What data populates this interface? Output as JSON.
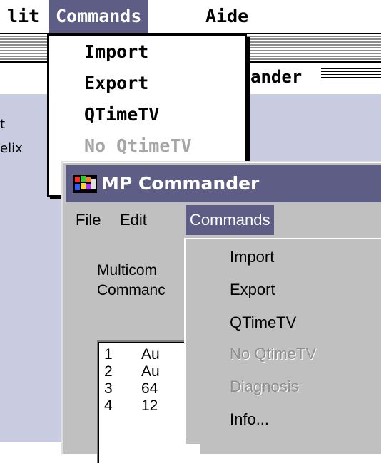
{
  "mac_window": {
    "menubar": {
      "items": [
        {
          "label": "lit",
          "selected": false
        },
        {
          "label": "Commands",
          "selected": true
        },
        {
          "label": "Aide",
          "selected": false
        }
      ]
    },
    "title_partial": "ander",
    "side_texts": [
      "t",
      "elix"
    ],
    "commands_menu": [
      {
        "label": "Import",
        "enabled": true
      },
      {
        "label": "Export",
        "enabled": true
      },
      {
        "label": "QTimeTV",
        "enabled": true
      },
      {
        "label": "No QtimeTV",
        "enabled": false
      }
    ]
  },
  "win_window": {
    "title": "MP Commander",
    "app_icon": "multicolor-flag-icon",
    "menubar": {
      "items": [
        {
          "label": "File",
          "selected": false
        },
        {
          "label": "Edit",
          "selected": false
        },
        {
          "label": "Commands",
          "selected": true
        }
      ]
    },
    "body_lines": [
      "Multicom",
      "Commanc"
    ],
    "list_rows": [
      {
        "num": "1",
        "text": "Au"
      },
      {
        "num": "2",
        "text": "Au"
      },
      {
        "num": "3",
        "text": "64"
      },
      {
        "num": "4",
        "text": "12"
      }
    ],
    "commands_menu": [
      {
        "label": "Import",
        "enabled": true
      },
      {
        "label": "Export",
        "enabled": true
      },
      {
        "label": "QTimeTV",
        "enabled": true
      },
      {
        "label": "No QtimeTV",
        "enabled": false
      },
      {
        "label": "Diagnosis",
        "enabled": false
      },
      {
        "label": "Info...",
        "enabled": true
      }
    ]
  },
  "colors": {
    "selection": "#5d5d86",
    "mac_content_bg": "#c9cbe0",
    "win_face": "#c0c0c0",
    "disabled_text": "#8e8e8e"
  }
}
